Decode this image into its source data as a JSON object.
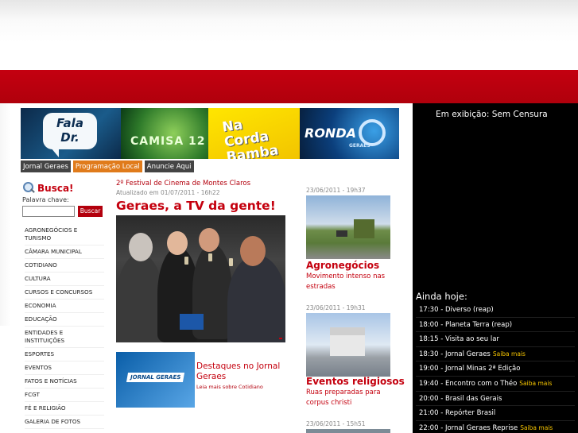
{
  "banners": [
    {
      "line1": "Fala",
      "line2": "Dr."
    },
    {
      "label": "CAMISA 12"
    },
    {
      "label": "Na Corda Bamba"
    },
    {
      "label": "RONDA",
      "sub": "GERAES"
    }
  ],
  "tabs": [
    "Jornal Geraes",
    "Programação Local",
    "Anuncie Aqui"
  ],
  "busca": {
    "title": "Busca!",
    "keyword_label": "Palavra chave:",
    "button": "Buscar"
  },
  "categories": [
    "AGRONEGÓCIOS E TURISMO",
    "CÂMARA MUNICIPAL",
    "COTIDIANO",
    "CULTURA",
    "CURSOS E CONCURSOS",
    "ECONOMIA",
    "EDUCAÇÃO",
    "ENTIDADES E INSTITUIÇÕES",
    "ESPORTES",
    "EVENTOS",
    "FATOS E NOTÍCIAS",
    "FCGT",
    "FÉ E RELIGIÃO",
    "GALERIA DE FOTOS"
  ],
  "article": {
    "kicker": "2º Festival de Cinema de Montes Claros",
    "updated": "Atualizado em 01/07/2011 - 16h22",
    "headline": "Geraes, a TV da gente!"
  },
  "destaques": {
    "badge": "JORNAL GERAES",
    "title": "Destaques no Jornal Geraes",
    "link": "Leia mais sobre Cotidiano"
  },
  "news": [
    {
      "date": "23/06/2011 - 19h37",
      "title": "Agronegócios",
      "sub": "Movimento intenso nas estradas"
    },
    {
      "date": "23/06/2011 - 19h31",
      "title": "Eventos religiosos",
      "sub": "Ruas preparadas para corpus christi"
    },
    {
      "date": "23/06/2011 - 15h51"
    }
  ],
  "tv": {
    "now_showing": "Em exibição: Sem Censura",
    "today_title": "Ainda hoje:",
    "saiba_mais": "Saiba mais",
    "schedule": [
      {
        "text": "17:30 - Diverso (reap)",
        "more": false
      },
      {
        "text": "18:00 - Planeta Terra (reap)",
        "more": false
      },
      {
        "text": "18:15 - Visita ao seu lar",
        "more": false
      },
      {
        "text": "18:30 - Jornal Geraes",
        "more": true
      },
      {
        "text": "19:00 - Jornal Minas 2ª Edição",
        "more": false
      },
      {
        "text": "19:40 - Encontro com o Théo",
        "more": true
      },
      {
        "text": "20:00 - Brasil das Gerais",
        "more": false
      },
      {
        "text": "21:00 - Repórter Brasil",
        "more": false
      },
      {
        "text": "22:00 - Jornal Geraes Reprise",
        "more": true
      }
    ]
  },
  "colors": {
    "brand_red": "#c4000e",
    "accent_orange": "#e07b1b",
    "tv_bg": "#000000",
    "saiba_mais": "#f5c400"
  }
}
